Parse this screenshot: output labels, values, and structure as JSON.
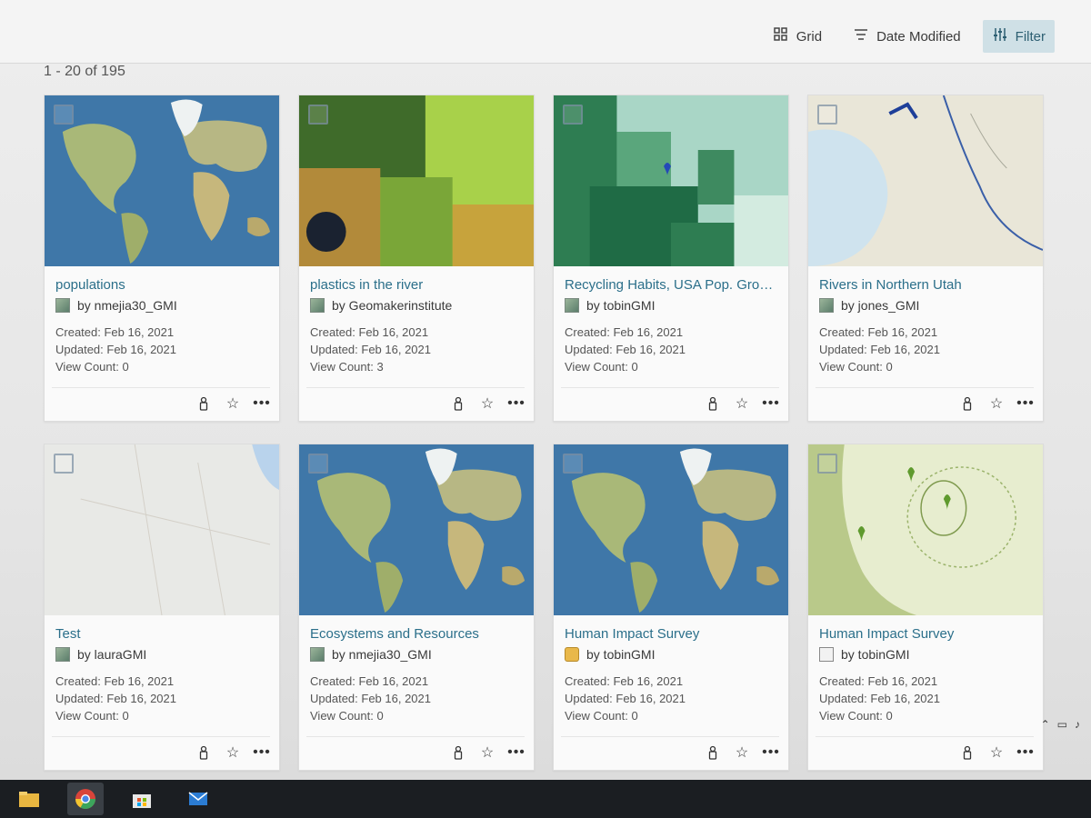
{
  "toolbar": {
    "grid_label": "Grid",
    "sort_label": "Date Modified",
    "filter_label": "Filter"
  },
  "results": {
    "count_text": "1 - 20 of 195"
  },
  "cards": [
    {
      "title": "populations",
      "owner": "by nmejia30_GMI",
      "type": "map",
      "thumb": "world",
      "created": "Created: Feb 16, 2021",
      "updated": "Updated: Feb 16, 2021",
      "views": "View Count: 0"
    },
    {
      "title": "plastics in the river",
      "owner": "by Geomakerinstitute",
      "type": "map",
      "thumb": "terrain",
      "created": "Created: Feb 16, 2021",
      "updated": "Updated: Feb 16, 2021",
      "views": "View Count: 3"
    },
    {
      "title": "Recycling Habits, USA Pop. Grow...",
      "owner": "by tobinGMI",
      "type": "map",
      "thumb": "choropleth",
      "created": "Created: Feb 16, 2021",
      "updated": "Updated: Feb 16, 2021",
      "views": "View Count: 0"
    },
    {
      "title": "Rivers in Northern Utah",
      "owner": "by jones_GMI",
      "type": "map",
      "thumb": "topo",
      "created": "Created: Feb 16, 2021",
      "updated": "Updated: Feb 16, 2021",
      "views": "View Count: 0"
    },
    {
      "title": "Test",
      "owner": "by lauraGMI",
      "type": "map",
      "thumb": "street",
      "created": "Created: Feb 16, 2021",
      "updated": "Updated: Feb 16, 2021",
      "views": "View Count: 0"
    },
    {
      "title": "Ecosystems and Resources",
      "owner": "by nmejia30_GMI",
      "type": "map",
      "thumb": "world",
      "created": "Created: Feb 16, 2021",
      "updated": "Updated: Feb 16, 2021",
      "views": "View Count: 0"
    },
    {
      "title": "Human Impact Survey",
      "owner": "by tobinGMI",
      "type": "pin",
      "thumb": "world",
      "created": "Created: Feb 16, 2021",
      "updated": "Updated: Feb 16, 2021",
      "views": "View Count: 0"
    },
    {
      "title": "Human Impact Survey",
      "owner": "by tobinGMI",
      "type": "doc",
      "thumb": "survey",
      "created": "Created: Feb 16, 2021",
      "updated": "Updated: Feb 16, 2021",
      "views": "View Count: 0"
    }
  ],
  "colors": {
    "title_link": "#2b6f8a",
    "filter_active_bg": "#cfe0e6",
    "ocean": "#3f77a8",
    "land": "#a9b878"
  },
  "icons": {
    "grid": "grid-icon",
    "sort": "sort-icon",
    "filter": "filter-icon",
    "share": "share-icon",
    "favorite": "star-icon",
    "more": "more-icon"
  }
}
